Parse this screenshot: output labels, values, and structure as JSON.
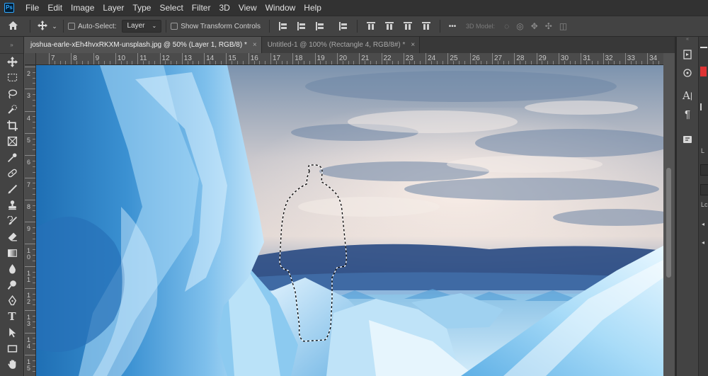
{
  "app": {
    "logo_text": "Ps"
  },
  "menu": [
    "File",
    "Edit",
    "Image",
    "Layer",
    "Type",
    "Select",
    "Filter",
    "3D",
    "View",
    "Window",
    "Help"
  ],
  "options_bar": {
    "auto_select_label": "Auto-Select:",
    "auto_select_target": "Layer",
    "show_transform_label": "Show Transform Controls",
    "more_label": "•••",
    "mode_3d_label": "3D Model:"
  },
  "tabs": [
    {
      "label": "joshua-earle-xEh4hvxRKXM-unsplash.jpg @ 50% (Layer 1, RGB/8) *",
      "active": true
    },
    {
      "label": "Untitled-1 @ 100% (Rectangle 4, RGB/8#) *",
      "active": false
    }
  ],
  "tab_close": "×",
  "ruler_top": [
    "7",
    "8",
    "9",
    "10",
    "11",
    "12",
    "13",
    "14",
    "15",
    "16",
    "17",
    "18",
    "19",
    "20",
    "21",
    "22",
    "23",
    "24",
    "25",
    "26",
    "27",
    "28",
    "29",
    "30",
    "31",
    "32",
    "33",
    "34"
  ],
  "ruler_left": [
    "2",
    "3",
    "4",
    "5",
    "6",
    "7",
    "8",
    "9",
    "10",
    "11",
    "12",
    "13",
    "14",
    "15"
  ],
  "tools": [
    "move-tool",
    "marquee-tool",
    "lasso-tool",
    "quick-select-tool",
    "crop-tool",
    "frame-tool",
    "eyedropper-tool",
    "healing-brush-tool",
    "brush-tool",
    "clone-stamp-tool",
    "history-brush-tool",
    "eraser-tool",
    "gradient-tool",
    "blur-tool",
    "dodge-tool",
    "pen-tool",
    "type-tool",
    "path-select-tool",
    "rectangle-tool",
    "hand-tool"
  ],
  "tools_type_glyph": "T",
  "panel_icons": [
    "history-icon",
    "properties-icon",
    "character-icon",
    "paragraph-icon",
    "glyphs-icon"
  ],
  "panel_character_glyph": "A",
  "panel_paragraph_glyph": "¶",
  "right_panel_labels": [
    "L",
    "Lc"
  ],
  "colors": {
    "selection": "#000000",
    "accent": "#31a8ff"
  }
}
